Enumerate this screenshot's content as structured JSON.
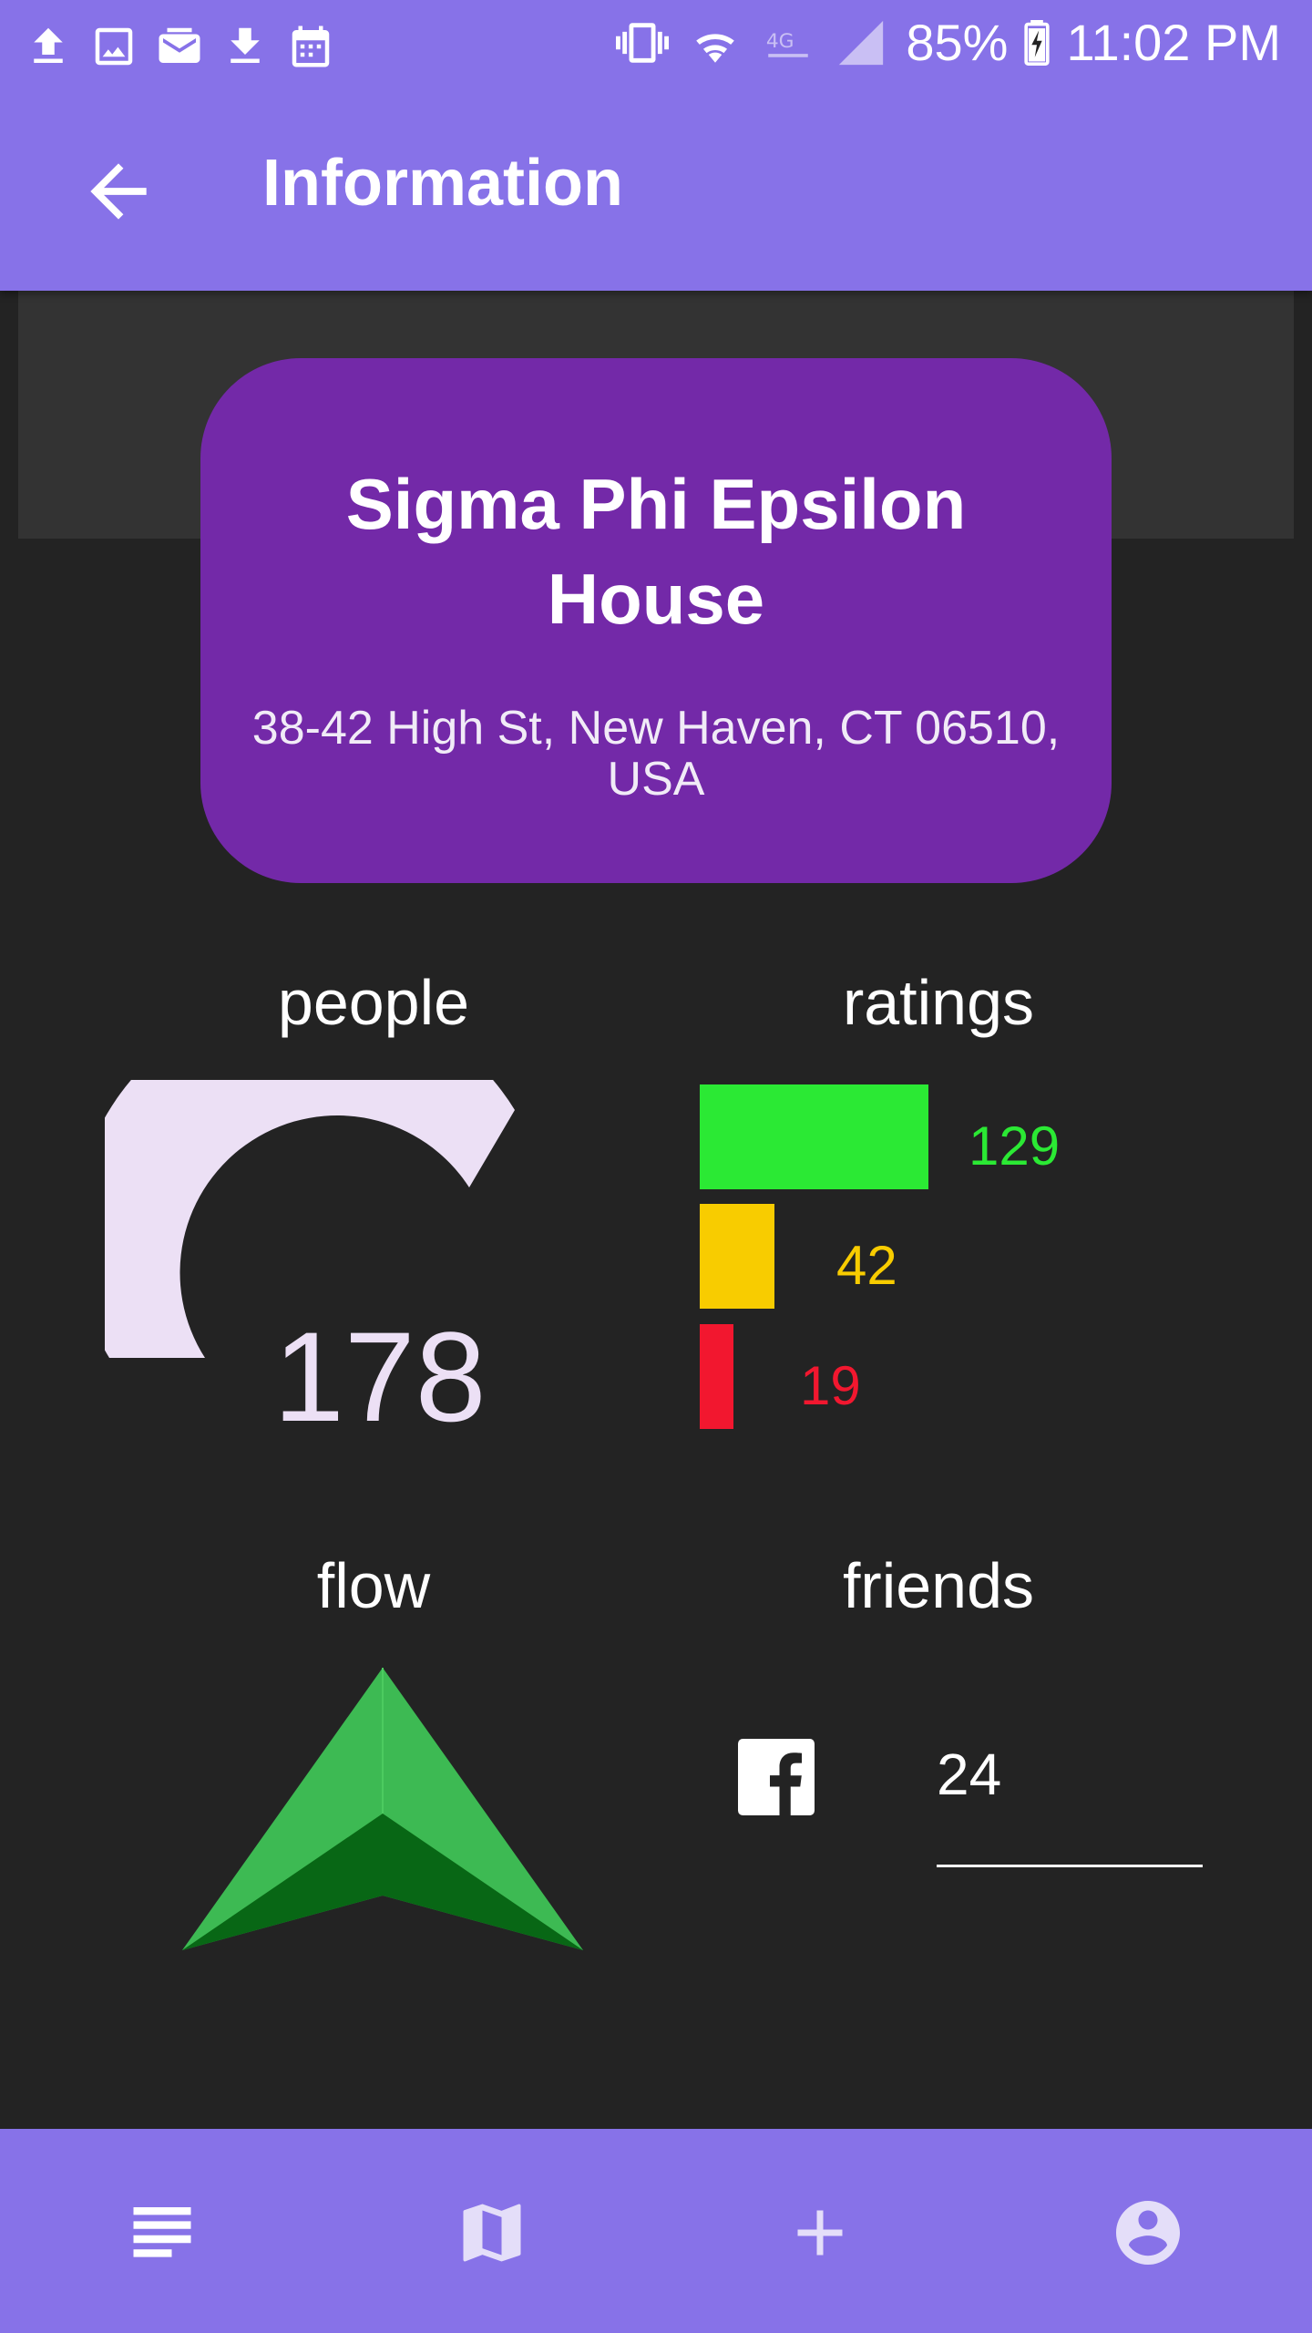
{
  "status_bar": {
    "battery": "85%",
    "time": "11:02 PM",
    "icons": [
      "upload-icon",
      "image-icon",
      "mail-icon",
      "download-icon",
      "calendar-icon",
      "vibrate-icon",
      "wifi-icon",
      "lte-icon",
      "signal-icon",
      "battery-charging-icon"
    ]
  },
  "app_bar": {
    "title": "Information",
    "back_icon": "arrow-back-icon"
  },
  "place": {
    "name": "Sigma Phi Epsilon House",
    "address": "38-42 High St, New Haven, CT 06510, USA"
  },
  "people": {
    "label": "people",
    "count": "178"
  },
  "ratings": {
    "label": "ratings",
    "items": [
      {
        "value": "129",
        "color": "#2be934"
      },
      {
        "value": "42",
        "color": "#f8cc00"
      },
      {
        "value": "19",
        "color": "#f2172f"
      }
    ]
  },
  "flow": {
    "label": "flow",
    "direction": "up",
    "colors": {
      "light": "#3dba53",
      "dark": "#086715"
    }
  },
  "friends": {
    "label": "friends",
    "icon": "facebook-icon",
    "count": "24"
  },
  "bottom_nav": {
    "items": [
      "list-icon",
      "map-icon",
      "add-icon",
      "account-icon"
    ]
  },
  "colors": {
    "primary": "#8772e8",
    "card": "#7329a8",
    "background": "#232323",
    "gauge": "#ece0f5"
  }
}
